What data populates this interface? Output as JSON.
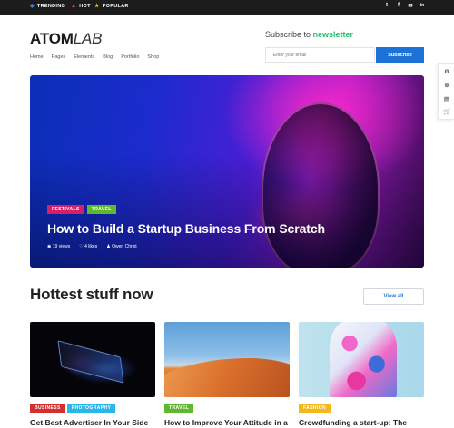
{
  "topbar": {
    "items": [
      {
        "label": "TRENDING",
        "icon": "bolt-icon",
        "color": "#3b82f6"
      },
      {
        "label": "HOT",
        "icon": "flame-icon",
        "color": "#ef4444"
      },
      {
        "label": "POPULAR",
        "icon": "star-icon",
        "color": "#f5c518"
      }
    ],
    "social": [
      {
        "name": "twitter-icon",
        "glyph": "t"
      },
      {
        "name": "facebook-icon",
        "glyph": "f"
      },
      {
        "name": "mail-icon",
        "glyph": "✉"
      },
      {
        "name": "linkedin-icon",
        "glyph": "in"
      }
    ]
  },
  "header": {
    "logo_bold": "ATOM",
    "logo_italic": "LAB",
    "nav": [
      "Home",
      "Pages",
      "Elements",
      "Blog",
      "Portfolio",
      "Shop"
    ],
    "newsletter_prefix": "Subscribe to ",
    "newsletter_highlight": "newsletter",
    "email_placeholder": "Enter your email",
    "subscribe_label": "Subscribe"
  },
  "rail": [
    "gear-icon",
    "lifebuoy-icon",
    "document-icon",
    "cart-icon"
  ],
  "hero": {
    "tags": [
      {
        "label": "FESTIVALS",
        "color": "#d61f69"
      },
      {
        "label": "TRAVEL",
        "color": "#5fb92f"
      }
    ],
    "title": "How to Build a Startup Business From Scratch",
    "views": "19 views",
    "likes": "4 likes",
    "author": "Owen Christ"
  },
  "section": {
    "title": "Hottest stuff now",
    "view_all": "View all"
  },
  "cards": [
    {
      "tags": [
        {
          "label": "BUSINESS",
          "color": "#d32f2f"
        },
        {
          "label": "PHOTOGRAPHY",
          "color": "#29b6e8"
        }
      ],
      "title": "Get Best Advertiser In Your Side"
    },
    {
      "tags": [
        {
          "label": "TRAVEL",
          "color": "#5fb92f"
        }
      ],
      "title": "How to Improve Your Attitude in a"
    },
    {
      "tags": [
        {
          "label": "FASHION",
          "color": "#f5b81c"
        }
      ],
      "title": "Crowdfunding a start-up: The"
    }
  ],
  "colors": {
    "accent": "#1d72d8",
    "brand_green": "#2bbd6d"
  }
}
